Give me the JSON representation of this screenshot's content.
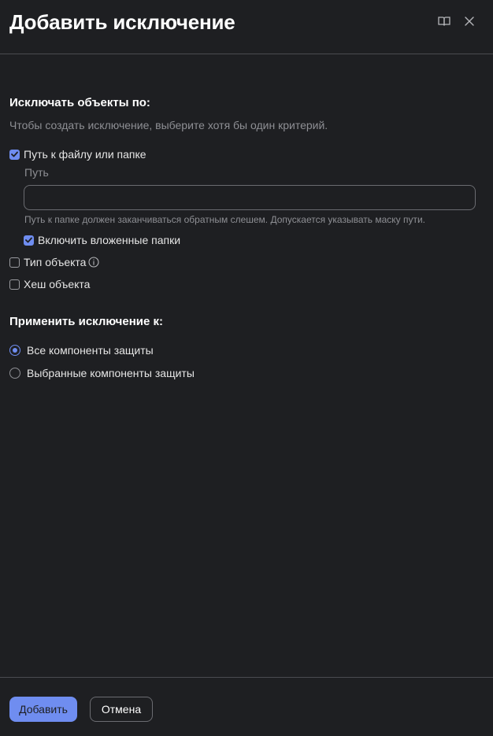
{
  "dialog": {
    "title": "Добавить исключение"
  },
  "exclude_section": {
    "title": "Исключать объекты по:",
    "hint": "Чтобы создать исключение, выберите хотя бы один критерий.",
    "path_option": {
      "label": "Путь к файлу или папке",
      "checked": true
    },
    "path_field": {
      "label": "Путь",
      "value": "",
      "hint": "Путь к папке должен заканчиваться обратным слешем. Допускается указывать маску пути."
    },
    "subfolders_option": {
      "label": "Включить вложенные папки",
      "checked": true
    },
    "type_option": {
      "label": "Тип объекта",
      "checked": false,
      "icon": "info-icon"
    },
    "hash_option": {
      "label": "Хеш объекта",
      "checked": false
    }
  },
  "apply_section": {
    "title": "Применить исключение к:",
    "options": [
      {
        "label": "Все компоненты защиты",
        "selected": true
      },
      {
        "label": "Выбранные компоненты защиты",
        "selected": false
      }
    ]
  },
  "footer": {
    "add_label": "Добавить",
    "cancel_label": "Отмена"
  },
  "icons": {
    "header": [
      "book-icon",
      "close-icon"
    ]
  },
  "colors": {
    "background": "#1e1f22",
    "accent": "#6f8df0",
    "muted_text": "#8e8f94",
    "border": "#4a4b50"
  }
}
